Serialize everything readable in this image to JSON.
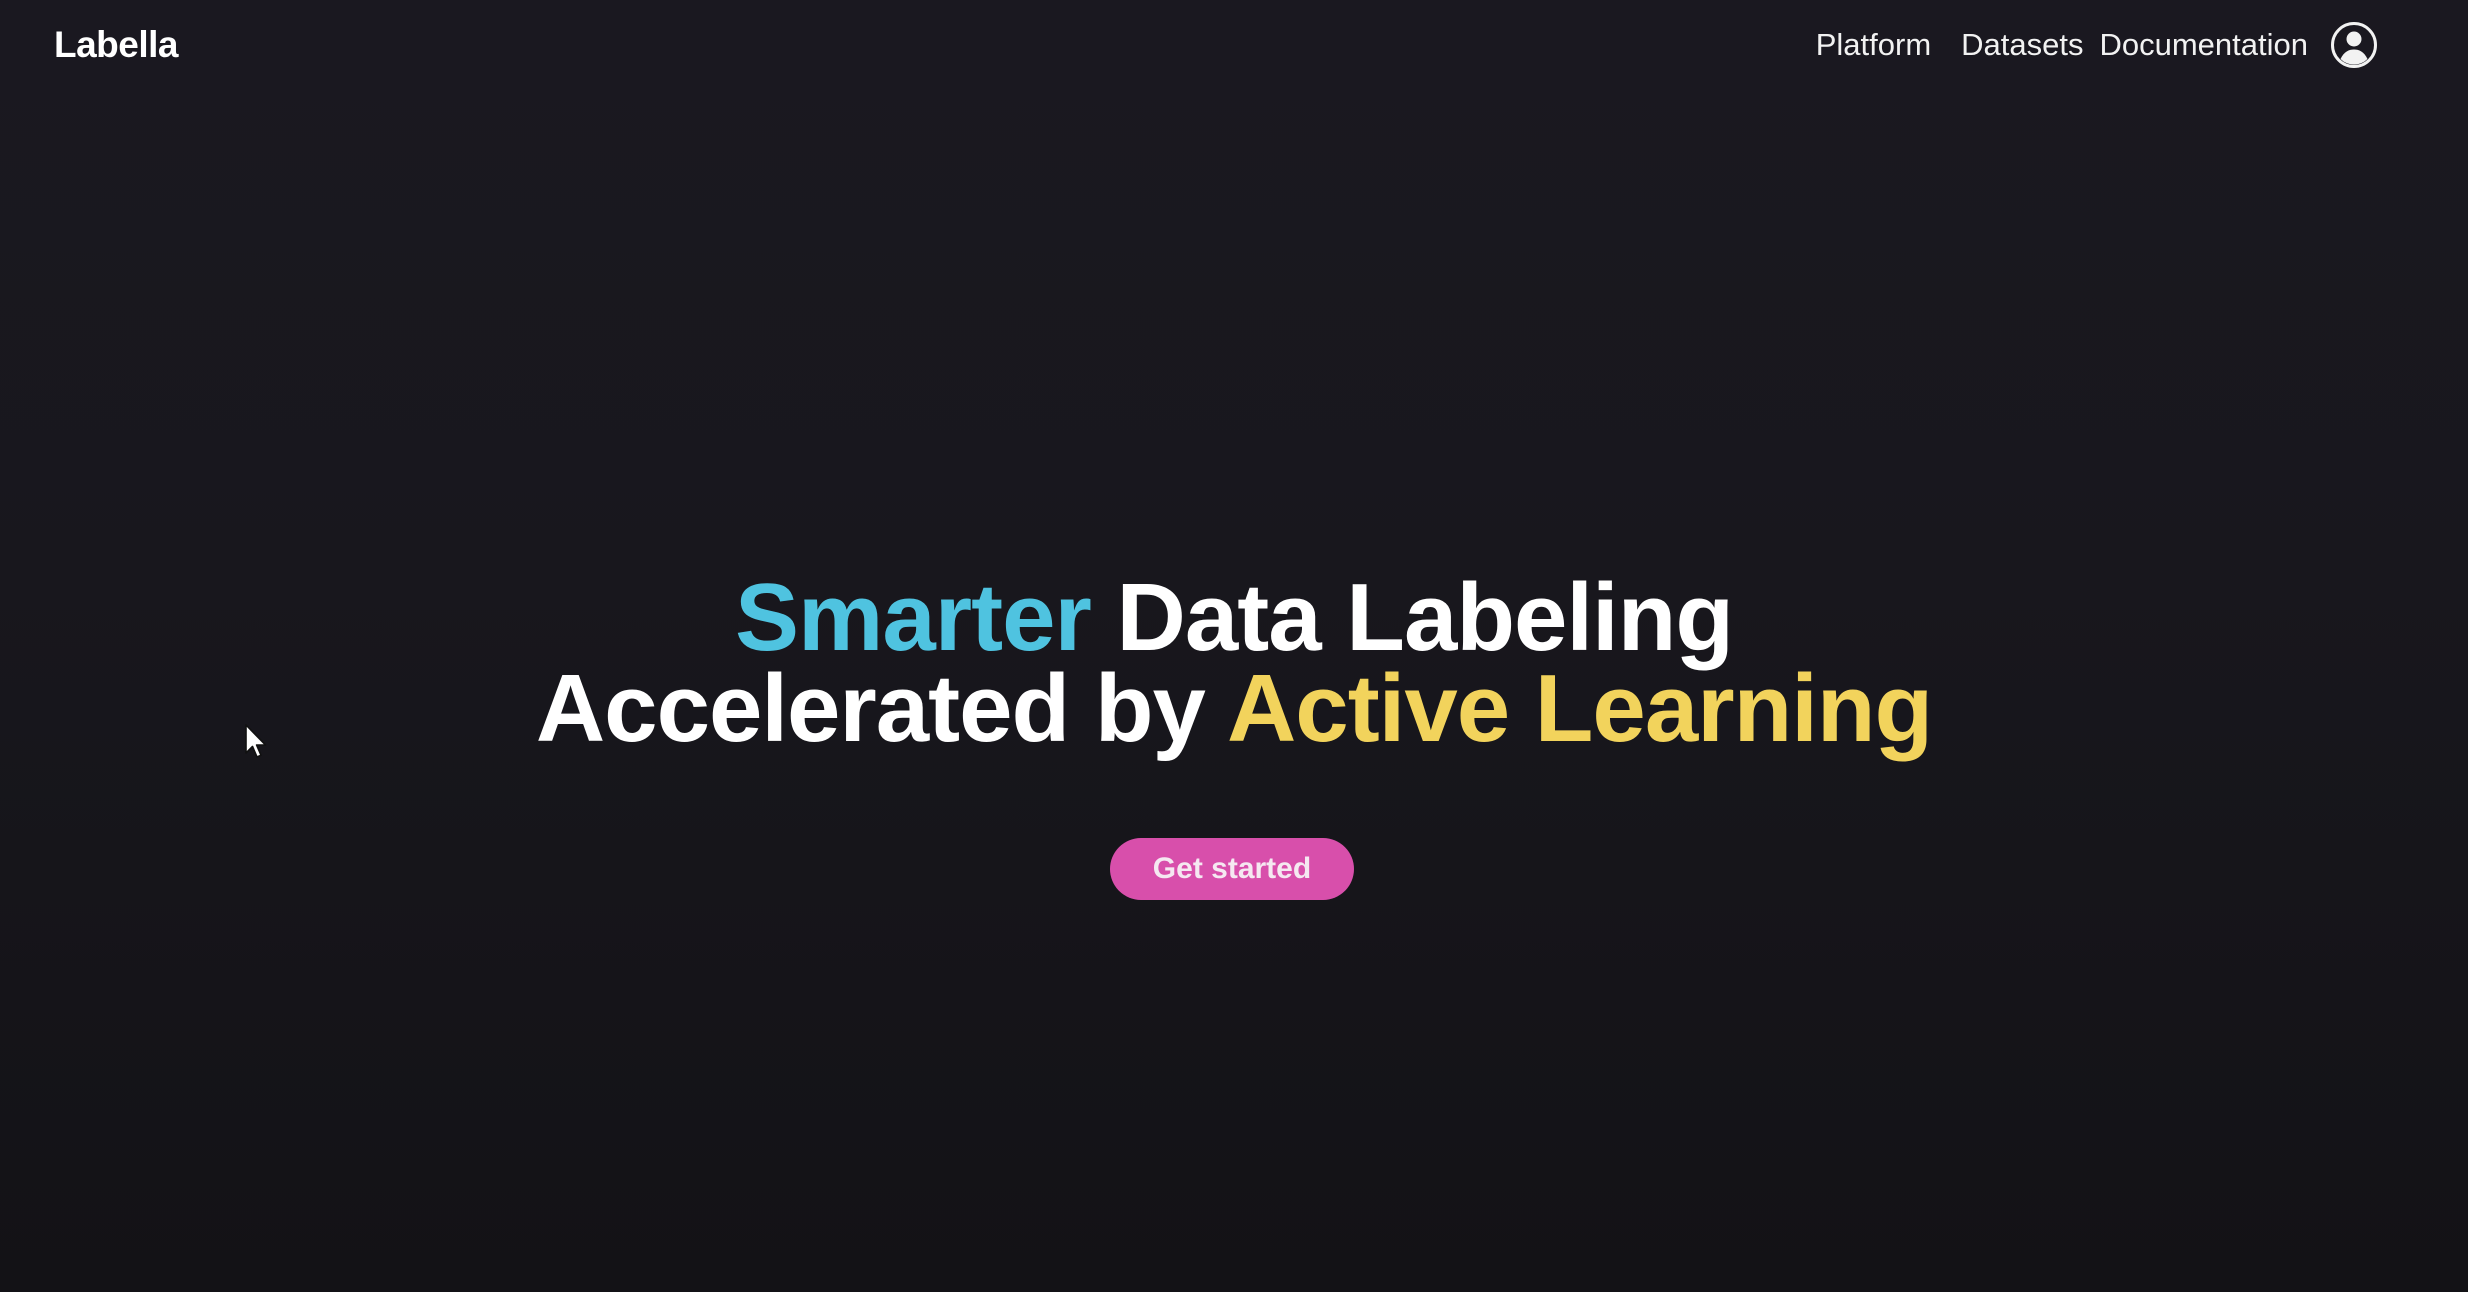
{
  "header": {
    "logo": "Labella",
    "nav": {
      "platform": "Platform",
      "datasets": "Datasets",
      "documentation": "Documentation"
    },
    "account_icon": "user-circle-icon"
  },
  "hero": {
    "line1": {
      "highlight": "Smarter",
      "rest": " Data Labeling"
    },
    "line2": {
      "rest": "Accelerated by ",
      "highlight": "Active Learning"
    }
  },
  "cta": {
    "label": "Get started"
  },
  "colors": {
    "background": "#18171d",
    "accent_blue": "#4fc3e0",
    "accent_yellow": "#f2d35c",
    "button_pink": "#d84fab"
  }
}
